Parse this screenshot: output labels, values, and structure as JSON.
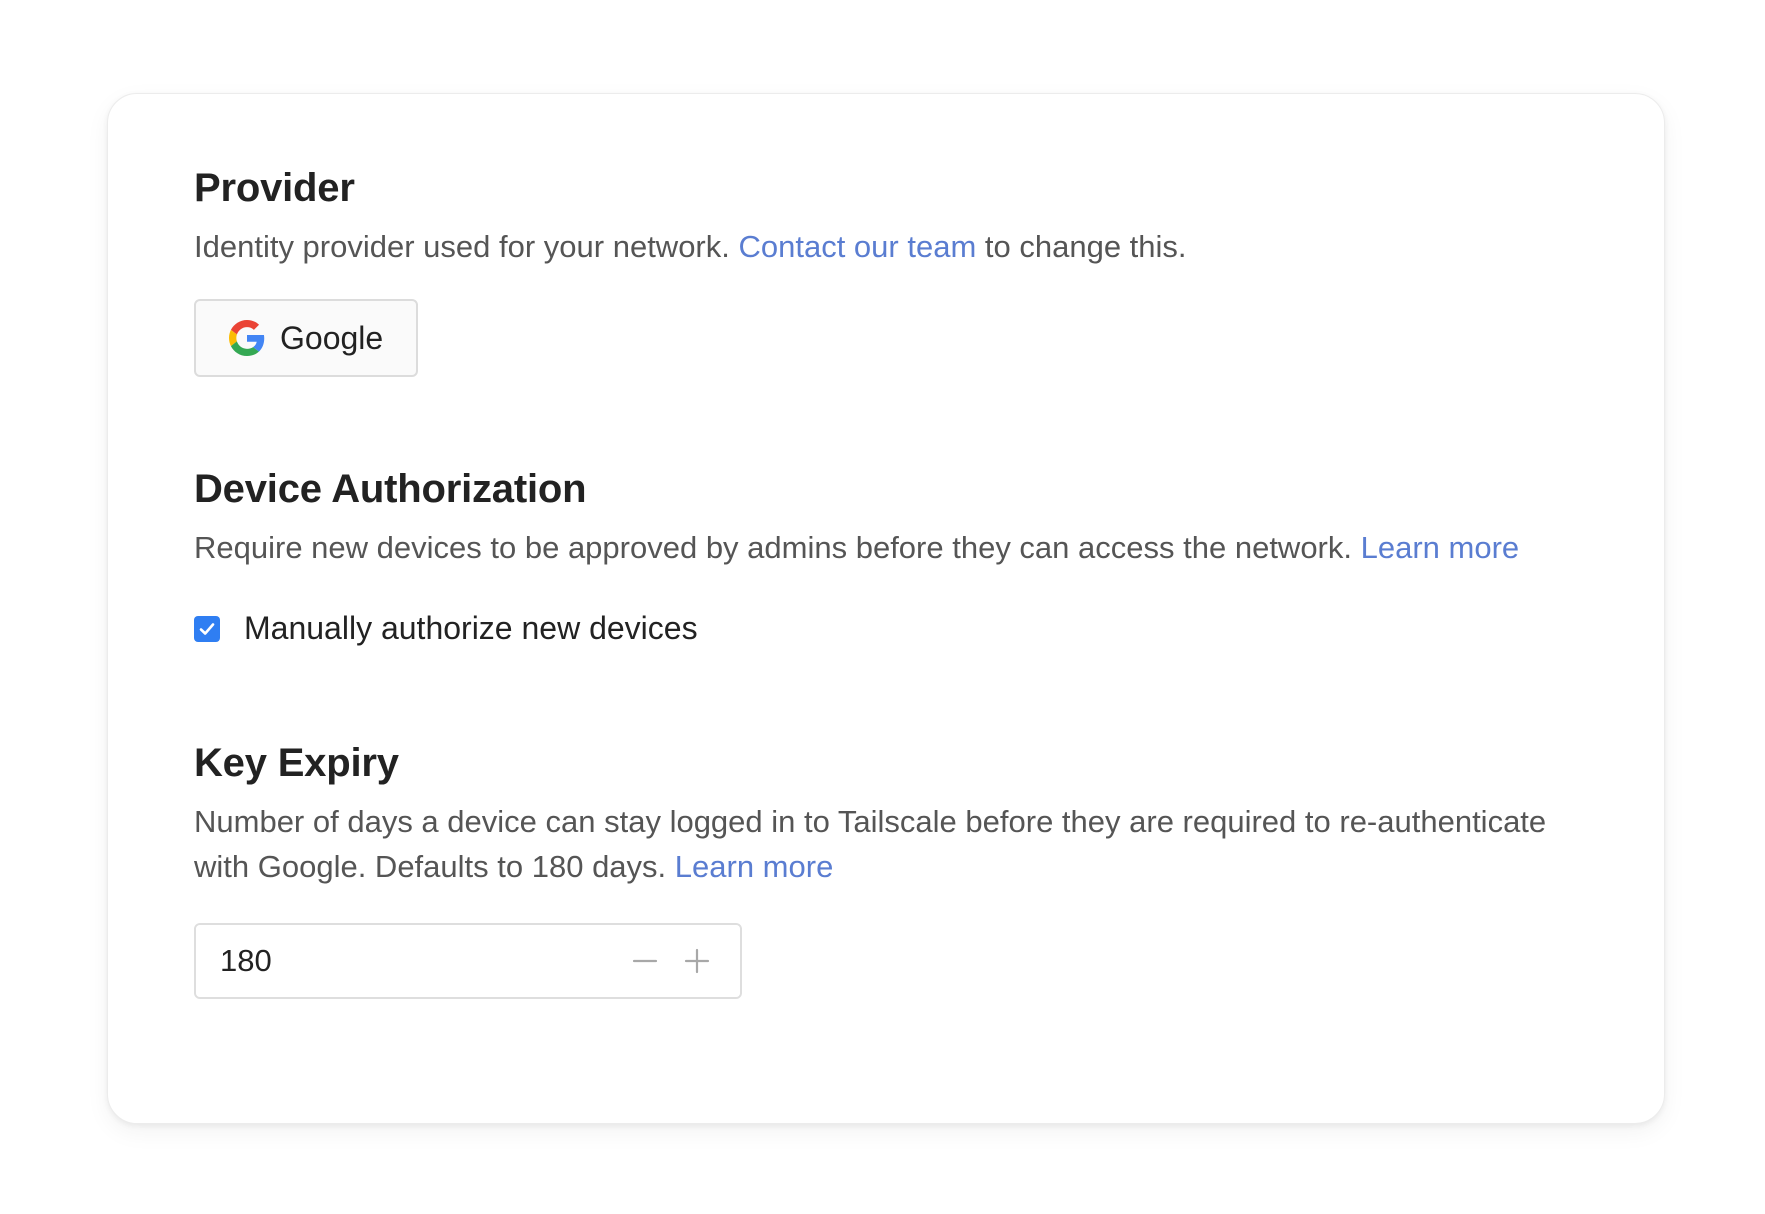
{
  "provider": {
    "title": "Provider",
    "description_prefix": "Identity provider used for your network. ",
    "description_link": "Contact our team",
    "description_suffix": " to change this.",
    "selected_provider": "Google",
    "provider_icon": "google-g-icon"
  },
  "device_authorization": {
    "title": "Device Authorization",
    "description": "Require new devices to be approved by admins before they can access the network. ",
    "learn_more": "Learn more",
    "checkbox_label": "Manually authorize new devices",
    "checkbox_checked": true
  },
  "key_expiry": {
    "title": "Key Expiry",
    "description": "Number of days a device can stay logged in to Tailscale before they are required to re-authenticate with Google. Defaults to 180 days. ",
    "learn_more": "Learn more",
    "value": "180",
    "unit": "days",
    "decrement_icon": "minus-icon",
    "increment_icon": "plus-icon"
  },
  "colors": {
    "link": "#5a7dd1",
    "checkbox": "#2f7ef2",
    "heading": "#222222",
    "body_text": "#555555"
  }
}
